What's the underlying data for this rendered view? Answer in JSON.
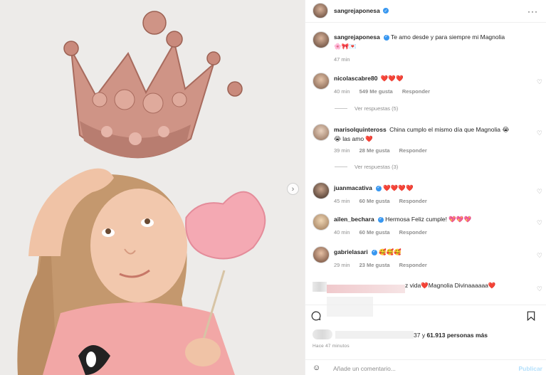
{
  "post": {
    "author": "sangrejaponesa",
    "caption": "Te amo desde y para siempre mi Magnolia",
    "caption_emoji": "🌸🎀💌",
    "caption_time": "47 min",
    "likes_prefix": "",
    "likes_count_suffix": "37 y",
    "likes_count": "61.913",
    "likes_tail": "personas más",
    "posted": "Hace 47 minutos"
  },
  "comments": [
    {
      "user": "nicolascabre80",
      "verified": false,
      "text": "❤️❤️❤️",
      "time": "40 min",
      "likes": "549 Me gusta",
      "reply": "Responder",
      "replies": "Ver respuestas (5)"
    },
    {
      "user": "marisolquinteross",
      "verified": false,
      "text": "China cumplo el mismo día que Magnolia 😭😭 las amo ❤️",
      "time": "39 min",
      "likes": "28 Me gusta",
      "reply": "Responder",
      "replies": "Ver respuestas (3)"
    },
    {
      "user": "juanmacativa",
      "verified": true,
      "text": "❤️❤️❤️❤️",
      "time": "45 min",
      "likes": "60 Me gusta",
      "reply": "Responder"
    },
    {
      "user": "ailen_bechara",
      "verified": true,
      "text": "Hermosa Feliz cumple! 💖💖💖",
      "time": "40 min",
      "likes": "60 Me gusta",
      "reply": "Responder"
    },
    {
      "user": "gabrielasari",
      "verified": true,
      "text": "🥰🥰🥰",
      "time": "29 min",
      "likes": "23 Me gusta",
      "reply": "Responder"
    },
    {
      "user": "",
      "verified": false,
      "text": "z vida❤️Magnolia Divinaaaaaa❤️"
    }
  ],
  "ui": {
    "more": "···",
    "next": "›",
    "comment_placeholder": "Añade un comentario...",
    "publish": "Publicar",
    "emoji_icon": "☺",
    "heart_icon": "♡",
    "bookmark_icon": "bookmark-icon",
    "comment_icon": "comment-icon"
  },
  "colors": {
    "verified": "#3897f0",
    "publish": "#b2dffc",
    "crown": "#d89a8a",
    "shirt": "#f2a7a6"
  }
}
